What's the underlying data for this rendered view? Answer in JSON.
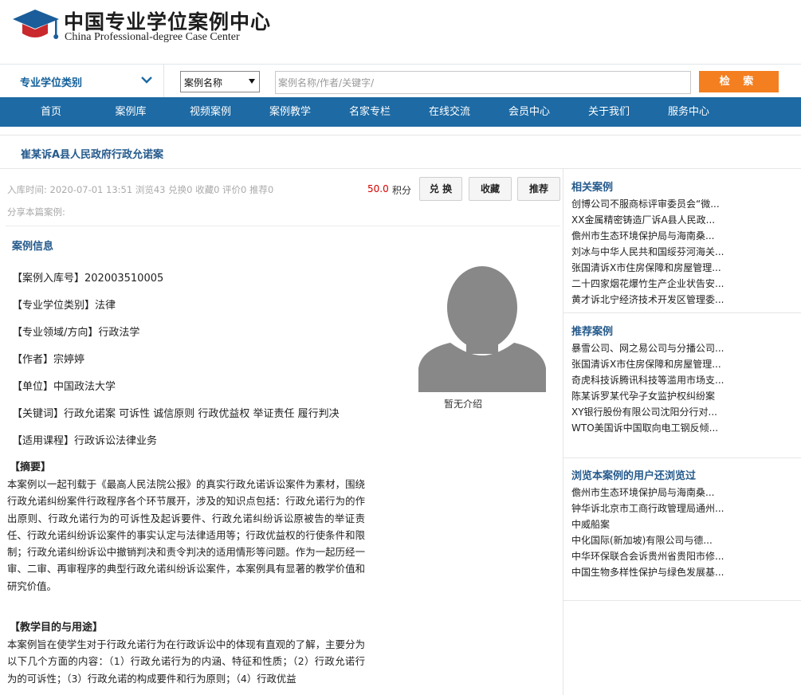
{
  "logo": {
    "cn": "中国专业学位案例中心",
    "en": "China Professional-degree Case Center"
  },
  "search": {
    "category_label": "专业学位类别",
    "type_selected": "案例名称",
    "placeholder": "案例名称/作者/关键字/",
    "button_label": "检 索"
  },
  "nav": [
    "首页",
    "案例库",
    "视频案例",
    "案例教学",
    "名家专栏",
    "在线交流",
    "会员中心",
    "关于我们",
    "服务中心"
  ],
  "case": {
    "title": "崔某诉A县人民政府行政允诺案",
    "meta": "入库时间: 2020-07-01 13:51   浏览43  兑换0 收藏0 评价0 推荐0",
    "score": "50.0",
    "score_unit": "积分",
    "btn_exchange": "兑 换",
    "btn_collect": "收藏",
    "btn_recommend": "推荐",
    "share": "分享本篇案例:",
    "section_title": "案例信息",
    "info": [
      {
        "label": "【案例入库号】",
        "value": "202003510005"
      },
      {
        "label": "【专业学位类别】",
        "value": "法律"
      },
      {
        "label": "【专业领域/方向】",
        "value": "行政法学"
      },
      {
        "label": "【作者】",
        "value": "宗婷婷"
      },
      {
        "label": "【单位】",
        "value": "中国政法大学"
      },
      {
        "label": "【关键词】",
        "value": "行政允诺案 可诉性 诚信原则 行政优益权 举证责任 履行判决"
      },
      {
        "label": "【适用课程】",
        "value": "行政诉讼法律业务"
      }
    ],
    "no_intro": "暂无介绍",
    "abstract_head": "【摘要】",
    "abstract": "本案例以一起刊载于《最高人民法院公报》的真实行政允诺诉讼案件为素材，围绕行政允诺纠纷案件行政程序各个环节展开，涉及的知识点包括：行政允诺行为的作出原则、行政允诺行为的可诉性及起诉要件、行政允诺纠纷诉讼原被告的举证责任、行政允诺纠纷诉讼案件的事实认定与法律适用等；行政优益权的行使条件和限制；行政允诺纠纷诉讼中撤销判决和责令判决的适用情形等问题。作为一起历经一审、二审、再审程序的典型行政允诺纠纷诉讼案件，本案例具有显著的教学价值和研究价值。",
    "purpose_head": "【教学目的与用途】",
    "purpose": "本案例旨在使学生对于行政允诺行为在行政诉讼中的体现有直观的了解，主要分为以下几个方面的内容：（1）行政允诺行为的内涵、特征和性质；（2）行政允诺行为的可诉性；（3）行政允诺的构成要件和行为原则；（4）行政优益"
  },
  "sidebar": {
    "related_title": "相关案例",
    "related": [
      "创博公司不服商标评审委员会“微...",
      "XX金属精密铸造厂诉A县人民政...",
      "儋州市生态环境保护局与海南桑...",
      "刘冰与中华人民共和国绥芬河海关...",
      "张国清诉X市住房保障和房屋管理...",
      "二十四家烟花爆竹生产企业状告安...",
      "黄才诉北宁经济技术开发区管理委..."
    ],
    "recommend_title": "推荐案例",
    "recommend": [
      "暴雪公司、网之易公司与分播公司...",
      "张国清诉X市住房保障和房屋管理...",
      "奇虎科技诉腾讯科技等滥用市场支...",
      "陈某诉罗某代孕子女监护权纠纷案",
      "XY银行股份有限公司沈阳分行对...",
      "WTO美国诉中国取向电工钢反倾..."
    ],
    "viewed_title": "浏览本案例的用户还浏览过",
    "viewed": [
      "儋州市生态环境保护局与海南桑...",
      "钟华诉北京市工商行政管理局通州...",
      "中威船案",
      "中化国际(新加坡)有限公司与德...",
      "中华环保联合会诉贵州省贵阳市修...",
      "中国生物多样性保护与绿色发展基..."
    ]
  },
  "colors": {
    "nav_bg": "#1d6aa4",
    "accent_blue": "#255a8c",
    "search_button": "#f47f20",
    "score_red": "#d60000"
  }
}
